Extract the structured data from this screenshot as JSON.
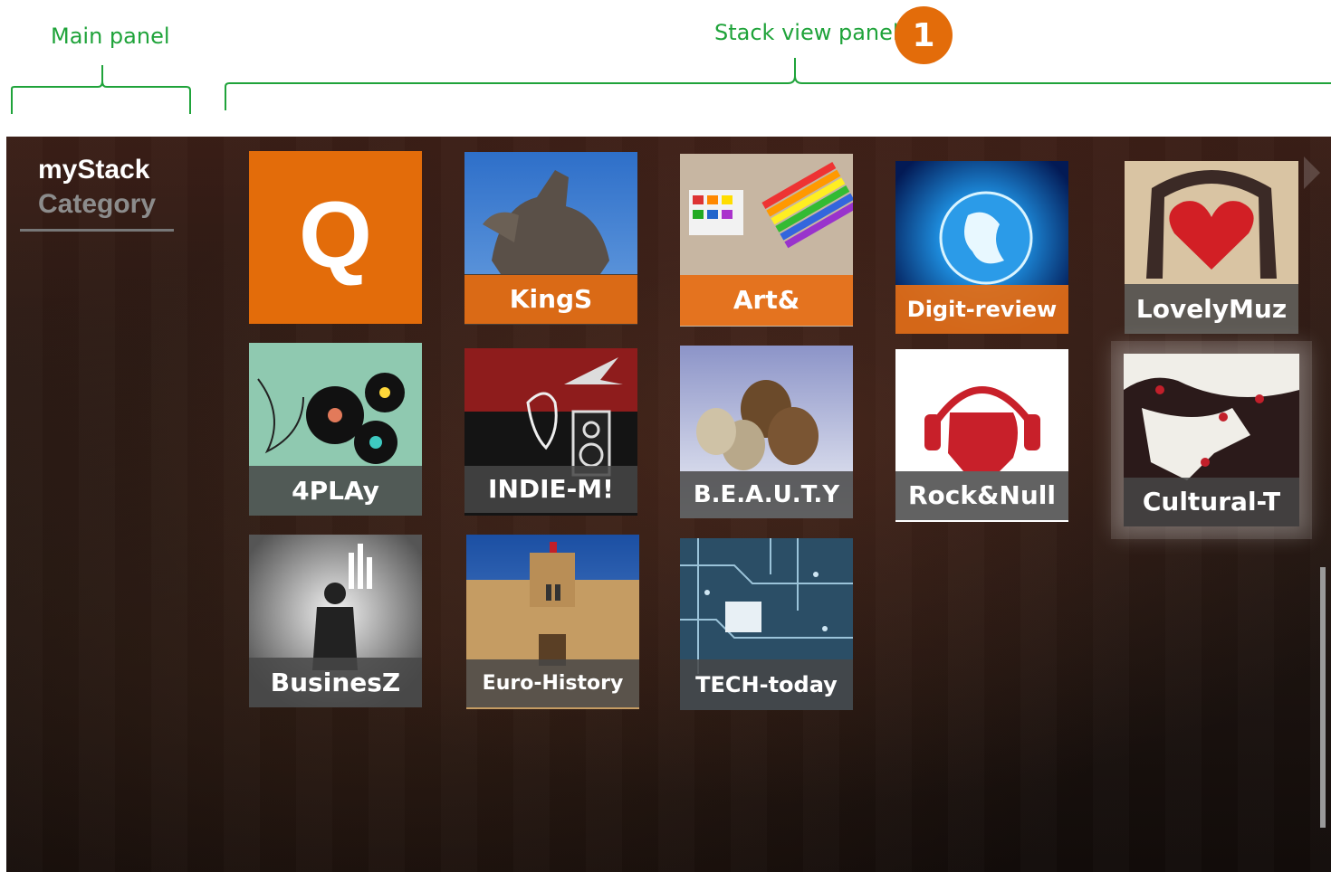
{
  "annotations": {
    "main_panel_label": "Main panel",
    "stack_view_label": "Stack view panel",
    "badge_number": "1"
  },
  "main_panel": {
    "title": "myStack",
    "subtitle": "Category"
  },
  "tiles": [
    {
      "label": "Q",
      "kind": "search-tile"
    },
    {
      "label": "KingS",
      "icon": "equestrian-statue-image"
    },
    {
      "label": "Art&",
      "icon": "paint-supplies-image"
    },
    {
      "label": "Digit-review",
      "icon": "digital-globe-image"
    },
    {
      "label": "LovelyMuz",
      "icon": "heart-headphones-image"
    },
    {
      "label": "4PLAy",
      "icon": "vinyl-records-image"
    },
    {
      "label": "INDIE-M!",
      "icon": "indie-music-art-image"
    },
    {
      "label": "B.E.A.U.T.Y",
      "icon": "balloons-image"
    },
    {
      "label": "Rock&Null",
      "icon": "fist-headphones-image"
    },
    {
      "label": "Cultural-T",
      "icon": "tree-art-image"
    },
    {
      "label": "BusinesZ",
      "icon": "business-man-image"
    },
    {
      "label": "Euro-History",
      "icon": "castle-image"
    },
    {
      "label": "TECH-today",
      "icon": "circuit-board-image"
    }
  ],
  "colors": {
    "accent": "#e36c0a",
    "annotation": "#1fa33a"
  }
}
